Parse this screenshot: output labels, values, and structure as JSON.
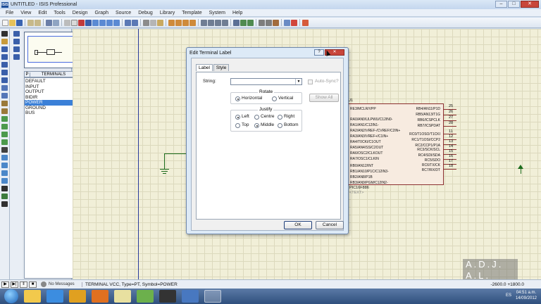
{
  "window": {
    "icon": "ISIS",
    "title": "UNTITLED - ISIS Professional",
    "min": "–",
    "max": "□",
    "close": "✕"
  },
  "menu": [
    "File",
    "View",
    "Edit",
    "Tools",
    "Design",
    "Graph",
    "Source",
    "Debug",
    "Library",
    "Template",
    "System",
    "Help"
  ],
  "panel": {
    "tab_p": "P",
    "terminals_header": "TERMINALS",
    "terminals": [
      "DEFAULT",
      "INPUT",
      "OUTPUT",
      "BIDIR",
      "POWER",
      "GROUND",
      "BUS"
    ],
    "selected": "POWER"
  },
  "chip": {
    "ref": "U1",
    "part": "PIC16F886",
    "text_placeholder": "<TEXT>",
    "left_pins": [
      "RE3/MCLR/VPP",
      "RA0/AN0/ULPWU/C12IN0-",
      "RA1/AN1/C12IN1-",
      "RA2/AN2/VREF-/CVREF/C2IN+",
      "RA3/AN3/VREF+/C1IN+",
      "RA4/T0CKI/C1OUT",
      "RA5/AN4/SS/C2OUT",
      "RA6/OSC2/CLKOUT",
      "RA7/OSC1/CLKIN",
      "RB0/AN12/INT",
      "RB1/AN10/P1C/C12IN3-",
      "RB2/AN8/P1B",
      "RB3/AN9/PGM/C12IN2-"
    ],
    "right_pins": [
      "RB4/AN11/P1D",
      "RB5/AN13/T1G",
      "RB6/ICSPCLK",
      "RB7/ICSPDAT",
      "RC0/T1OSO/T1CKI",
      "RC1/T1OSI/CCP2",
      "RC2/CCP1/P1A",
      "RC3/SCK/SCL",
      "RC4/SDI/SDA",
      "RC5/SDO",
      "RC6/TX/CK",
      "RC7/RX/DT"
    ],
    "right_pin_numbers": [
      "25",
      "26",
      "27",
      "28",
      "11",
      "12",
      "13",
      "14",
      "15",
      "16",
      "17",
      "18"
    ]
  },
  "dialog": {
    "title": "Edit Terminal Label",
    "help": "?",
    "close": "✕",
    "tabs": [
      "Label",
      "Style"
    ],
    "string_label": "String:",
    "string_value": "",
    "auto_sync": "Auto-Sync?",
    "show_all": "Show All",
    "rotate_group": "Rotate",
    "rotate_options": [
      "Horizontal",
      "Vertical"
    ],
    "rotate_selected": "Horizontal",
    "justify_group": "Justify",
    "justify_options": [
      "Left",
      "Centre",
      "Right",
      "Top",
      "Middle",
      "Bottom"
    ],
    "justify_selected": [
      "Left",
      "Middle"
    ],
    "ok": "OK",
    "cancel": "Cancel"
  },
  "status": {
    "messages": "No Messages",
    "text": "TERMINAL VCC, Type=PT, Symbol=POWER",
    "coords": "-2600.0   +1800.0"
  },
  "watermark": "A.D.J.\nA.L.",
  "taskbar": {
    "lang": "ES",
    "time": "04:51 a.m.",
    "date": "14/09/2012"
  }
}
